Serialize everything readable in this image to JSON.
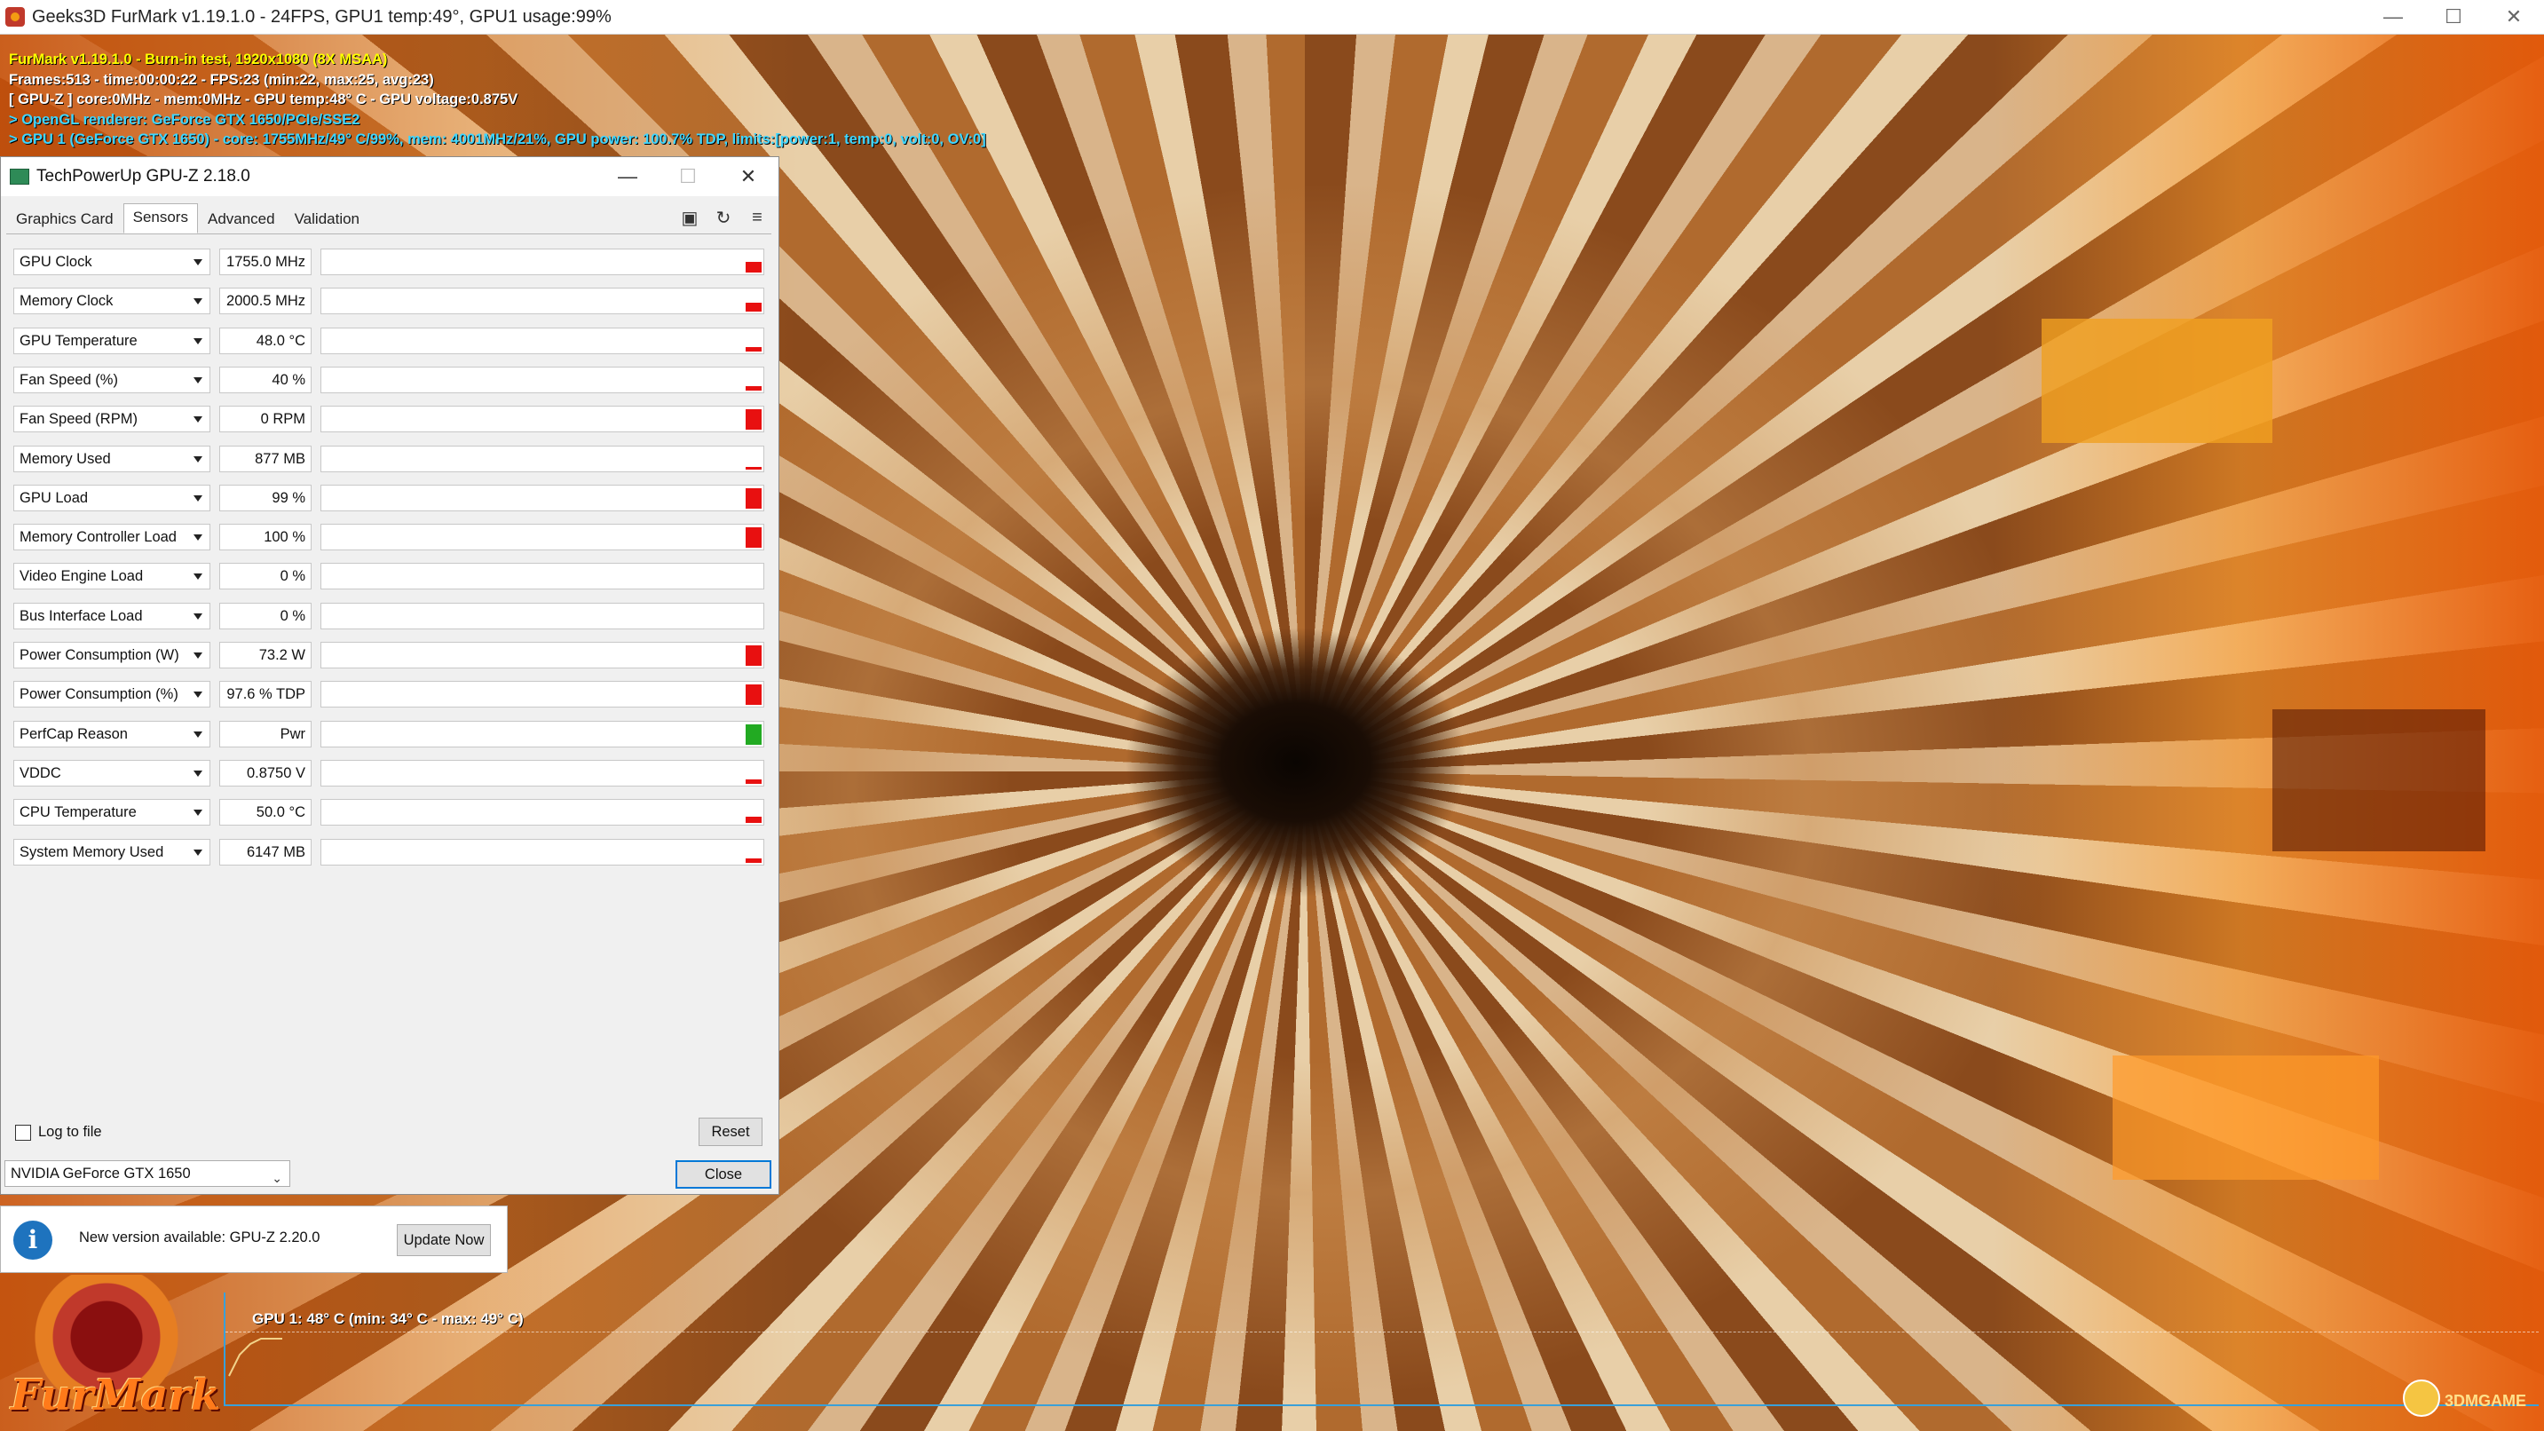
{
  "window": {
    "title": "Geeks3D FurMark v1.19.1.0 - 24FPS, GPU1 temp:49°, GPU1 usage:99%",
    "minimize": "—",
    "maximize": "☐",
    "close": "✕"
  },
  "osd": {
    "line1": "FurMark v1.19.1.0 - Burn-in test, 1920x1080 (8X MSAA)",
    "line2": "Frames:513 - time:00:00:22 - FPS:23 (min:22, max:25, avg:23)",
    "line3": "[ GPU-Z ] core:0MHz - mem:0MHz - GPU temp:48° C - GPU voltage:0.875V",
    "line4": "> OpenGL renderer: GeForce GTX 1650/PCIe/SSE2",
    "line5": "> GPU 1 (GeForce GTX 1650) - core: 1755MHz/49° C/99%, mem: 4001MHz/21%, GPU power: 100.7% TDP, limits:[power:1, temp:0, volt:0, OV:0]"
  },
  "gpuz": {
    "title": "TechPowerUp GPU-Z 2.18.0",
    "minimize": "—",
    "maximize": "☐",
    "close": "✕",
    "tabs": [
      {
        "label": "Graphics Card",
        "active": false
      },
      {
        "label": "Sensors",
        "active": true
      },
      {
        "label": "Advanced",
        "active": false
      },
      {
        "label": "Validation",
        "active": false
      }
    ],
    "tools": [
      {
        "name": "camera-icon",
        "glyph": "▣"
      },
      {
        "name": "refresh-icon",
        "glyph": "↻"
      },
      {
        "name": "menu-icon",
        "glyph": "≡"
      }
    ],
    "sensors": [
      {
        "label": "GPU Clock",
        "value": "1755.0 MHz",
        "level": 0.45,
        "color": "#e81010"
      },
      {
        "label": "Memory Clock",
        "value": "2000.5 MHz",
        "level": 0.4,
        "color": "#e81010"
      },
      {
        "label": "GPU Temperature",
        "value": "48.0 °C",
        "level": 0.2,
        "color": "#e81010"
      },
      {
        "label": "Fan Speed (%)",
        "value": "40 %",
        "level": 0.2,
        "color": "#e81010"
      },
      {
        "label": "Fan Speed (RPM)",
        "value": "0 RPM",
        "level": 0.9,
        "color": "#e81010"
      },
      {
        "label": "Memory Used",
        "value": "877 MB",
        "level": 0.1,
        "color": "#e81010"
      },
      {
        "label": "GPU Load",
        "value": "99 %",
        "level": 0.9,
        "color": "#e81010"
      },
      {
        "label": "Memory Controller Load",
        "value": "100 %",
        "level": 0.9,
        "color": "#e81010"
      },
      {
        "label": "Video Engine Load",
        "value": "0 %",
        "level": 0.0,
        "color": "#e81010"
      },
      {
        "label": "Bus Interface Load",
        "value": "0 %",
        "level": 0.0,
        "color": "#e81010"
      },
      {
        "label": "Power Consumption (W)",
        "value": "73.2 W",
        "level": 0.9,
        "color": "#e81010"
      },
      {
        "label": "Power Consumption (%)",
        "value": "97.6 % TDP",
        "level": 0.9,
        "color": "#e81010"
      },
      {
        "label": "PerfCap Reason",
        "value": "Pwr",
        "level": 0.9,
        "color": "#22aa22"
      },
      {
        "label": "VDDC",
        "value": "0.8750 V",
        "level": 0.2,
        "color": "#e81010"
      },
      {
        "label": "CPU Temperature",
        "value": "50.0 °C",
        "level": 0.25,
        "color": "#e81010"
      },
      {
        "label": "System Memory Used",
        "value": "6147 MB",
        "level": 0.2,
        "color": "#e81010"
      }
    ],
    "log_to_file": "Log to file",
    "reset": "Reset",
    "gpu_select": "NVIDIA GeForce GTX 1650",
    "close_button": "Close"
  },
  "notice": {
    "info_glyph": "i",
    "message": "New version available: GPU-Z 2.20.0",
    "button": "Update Now"
  },
  "furmark": {
    "logo_text": "FurMark",
    "graph_label": "GPU 1: 48° C (min: 34° C - max: 49° C)",
    "temperature_trace": [
      34,
      42,
      46,
      48,
      48,
      48
    ],
    "graph_color": "#3aa0d8"
  },
  "watermark": {
    "text": "3DMGAME"
  }
}
